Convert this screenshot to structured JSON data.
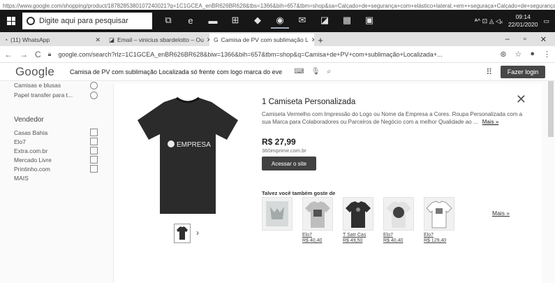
{
  "top_url": "https://www.google.com/shopping/product/1878285380107240021?q=1C1GCEA_enBR626BR628&tbs=1366&bih=657&tbm=shop&sa=Calçado+de+segurança+com+elástico+lateral,+em++seguraça+Calçado+de+segurança+com+elástico+lateral+=sa+=e",
  "taskbar": {
    "search_placeholder": "Digite aqui para pesquisar",
    "clock_time": "09:14",
    "clock_date": "22/01/2020",
    "tray_text": "ᴬ^ ⊡ ◬ ◁ₓ"
  },
  "tabs": [
    {
      "label": "(11) WhatsApp",
      "active": false
    },
    {
      "label": "Email – vinicius sbardelotto – Ou",
      "active": false
    },
    {
      "label": "Camisa de PV com sublimação L",
      "active": true
    }
  ],
  "window_controls": {
    "minimize": "–",
    "maximize": "▫",
    "close": "✕"
  },
  "address": {
    "back": "←",
    "forward": "→",
    "reload": "C",
    "url": "google.com/search?rlz=1C1GCEA_enBR626BR628&biw=1366&bih=657&tbm=shop&q=Camisa+de+PV+com+sublimação+Localizada+..."
  },
  "google": {
    "logo": "Google",
    "query": "Camisa de PV com sublimação Localizada só frente com logo marca do eve",
    "login_label": "Fazer login"
  },
  "filters": {
    "top": [
      {
        "label": "Camisas e blusas"
      },
      {
        "label": "Papel transfer para t..."
      }
    ],
    "vendor_heading": "Vendedor",
    "vendors": [
      {
        "label": "Casas Bahia"
      },
      {
        "label": "Elo7"
      },
      {
        "label": "Extra.com.br"
      },
      {
        "label": "Mercado Livre"
      },
      {
        "label": "Printinho.com"
      },
      {
        "label": "MAIS"
      }
    ]
  },
  "product": {
    "title": "1 Camiseta Personalizada",
    "description": "Camiseta Vermelho com Impressão do Logo ou Nome da Empresa a Cores. Roupa Personalizada com a sua Marca para Colaboradores ou Parceiros de Negócio com a melhor Qualidade ao ...",
    "more_label": "Mais »",
    "price": "R$ 27,99",
    "store": "360imprimir.com.br",
    "visit_label": "Acessar o site",
    "shirt_text": "EMPRESA",
    "thumb_next": "›",
    "close": "✕"
  },
  "also": {
    "heading": "Talvez você também goste de",
    "items": [
      {
        "name": "",
        "price": ""
      },
      {
        "name": "Elo7",
        "price": "R$ 40,40"
      },
      {
        "name": "T Satr Cas",
        "price": "R$ 49,50"
      },
      {
        "name": "Elo7",
        "price": "R$ 40,40"
      },
      {
        "name": "Elo7",
        "price": "R$ 129,40"
      }
    ],
    "more_label": "Mais »"
  }
}
